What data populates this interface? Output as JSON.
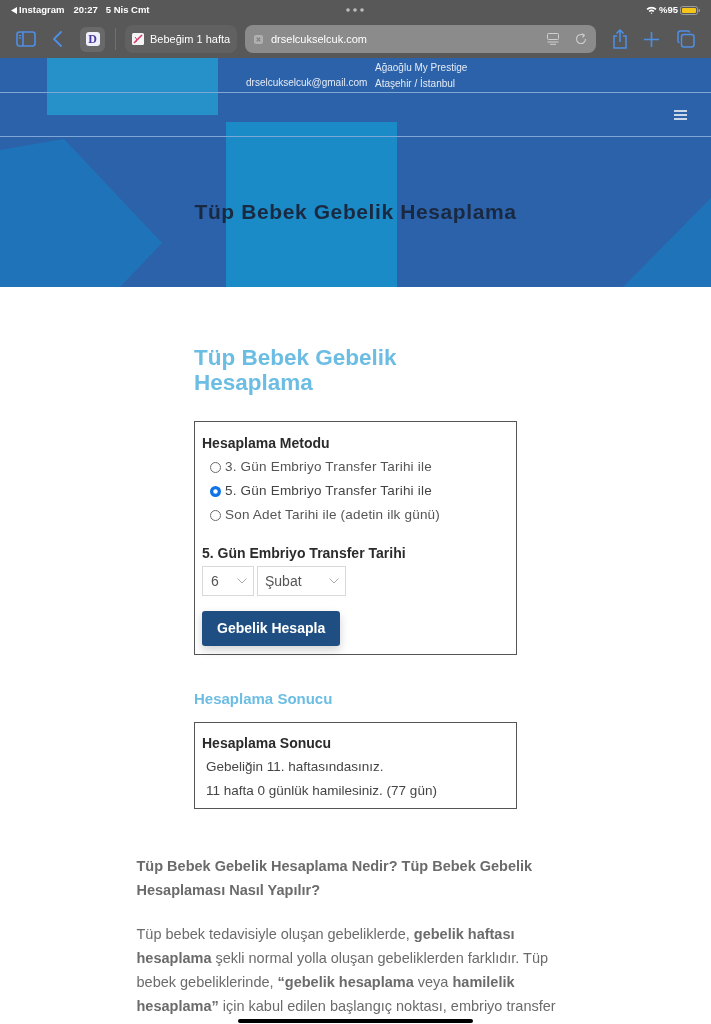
{
  "status_bar": {
    "back_app": "Instagram",
    "time": "20:27",
    "date": "5 Nis Cmt",
    "battery": "%95"
  },
  "browser": {
    "tab_group_letter": "D",
    "tab_title": "Bebeğim 1 hafta",
    "url": "drselcukselcuk.com"
  },
  "site_header": {
    "email": "drselcukselcuk@gmail.com",
    "address_lines": [
      "Ağaoğlu My Prestige",
      "Ataşehir / İstanbul"
    ],
    "hero_title": "Tüp Bebek Gebelik Hesaplama"
  },
  "calculator": {
    "title": "Tüp Bebek Gebelik Hesaplama",
    "method_label": "Hesaplama Metodu",
    "methods": [
      {
        "label": "3. Gün Embriyo Transfer Tarihi ile",
        "selected": false
      },
      {
        "label": "5. Gün Embriyo Transfer Tarihi ile",
        "selected": true
      },
      {
        "label": "Son Adet Tarihi ile (adetin ilk günü)",
        "selected": false
      }
    ],
    "date_label": "5. Gün Embriyo Transfer Tarihi",
    "day_select": {
      "value": "6"
    },
    "month_select": {
      "value": "Şubat"
    },
    "submit_button": "Gebelik Hesapla"
  },
  "result": {
    "heading": "Hesaplama Sonucu",
    "box_title": "Hesaplama Sonucu",
    "lines": [
      "Gebeliğin 11. haftasındasınız.",
      "11 hafta 0 günlük hamilesiniz. (77 gün)"
    ]
  },
  "article": {
    "heading": "Tüp Bebek Gebelik Hesaplama Nedir? Tüp Bebek Gebelik Hesaplaması Nasıl Yapılır?",
    "paragraph": "Tüp bebek tedavisiyle oluşan gebeliklerde, **gebelik haftası hesaplama** şekli normal yolla oluşan gebeliklerden farklıdır. Tüp bebek gebeliklerinde, **“gebelik hesaplama** veya **hamilelik hesaplama”** için kabul edilen başlangıç noktası, embriyo transfer"
  }
}
